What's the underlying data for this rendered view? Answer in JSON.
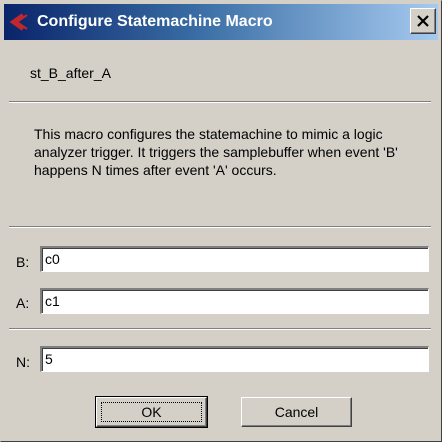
{
  "window": {
    "title": "Configure Statemachine Macro"
  },
  "macro": {
    "name": "st_B_after_A",
    "description": "This macro configures the statemachine to mimic a logic analyzer trigger. It triggers the samplebuffer when event 'B' happens N times after event 'A' occurs."
  },
  "fields": {
    "b": {
      "label": "B:",
      "value": "c0"
    },
    "a": {
      "label": "A:",
      "value": "c1"
    },
    "n": {
      "label": "N:",
      "value": "5"
    }
  },
  "buttons": {
    "ok_label": "OK",
    "cancel_label": "Cancel"
  },
  "colors": {
    "dialog_face": "#d4d0c8",
    "title_gradient_start": "#0a246a",
    "title_gradient_end": "#a6caf0",
    "icon_red": "#c0282d"
  },
  "icons": {
    "title": "app-logo-icon",
    "close": "close-icon"
  }
}
